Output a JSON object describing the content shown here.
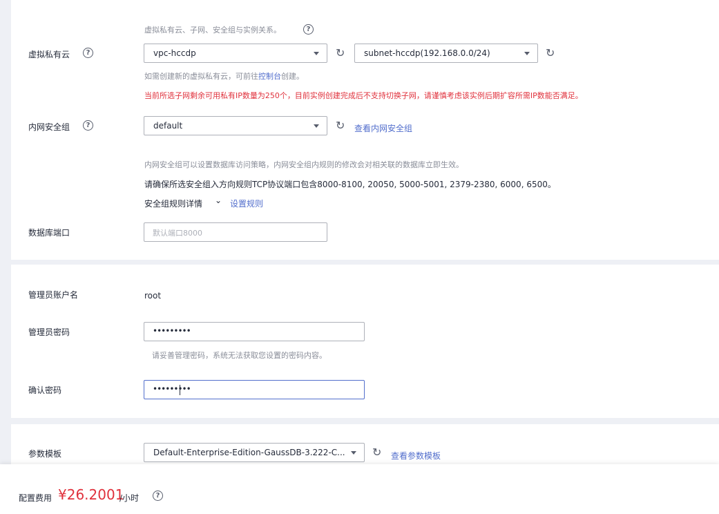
{
  "vpc": {
    "relation_hint": "虚拟私有云、子网、安全组与实例关系。",
    "label": "虚拟私有云",
    "vpc_value": "vpc-hccdp",
    "subnet_value": "subnet-hccdp(192.168.0.0/24)",
    "create_hint_prefix": "如需创建新的虚拟私有云，可前往",
    "create_hint_link": "控制台",
    "create_hint_suffix": "创建。",
    "warning": "当前所选子网剩余可用私有IP数量为250个，目前实例创建完成后不支持切换子网，请谨慎考虑该实例后期扩容所需IP数能否满足。"
  },
  "security_group": {
    "label": "内网安全组",
    "value": "default",
    "view_link": "查看内网安全组",
    "hint": "内网安全组可以设置数据库访问策略，内网安全组内规则的修改会对相关联的数据库立即生效。",
    "ports_note": "请确保所选安全组入方向规则TCP协议端口包含8000-8100, 20050, 5000-5001, 2379-2380, 6000, 6500。",
    "rules_detail": "安全组规则详情",
    "set_rules_link": "设置规则"
  },
  "db_port": {
    "label": "数据库端口",
    "placeholder": "默认端口8000"
  },
  "admin": {
    "account_label": "管理员账户名",
    "account_value": "root",
    "password_label": "管理员密码",
    "password_value": "•••••••••",
    "password_hint": "请妥善管理密码，系统无法获取您设置的密码内容。",
    "confirm_label": "确认密码",
    "confirm_value": "•••••••••"
  },
  "param_template": {
    "label": "参数模板",
    "value": "Default-Enterprise-Edition-GaussDB-3.222-C...",
    "view_link": "查看参数模板"
  },
  "footer": {
    "label": "配置费用",
    "price": "¥26.2001",
    "unit": "/小时"
  },
  "icons": {
    "help": "question-circle-icon",
    "refresh": "refresh-icon",
    "dropdown": "chevron-down-icon"
  },
  "colors": {
    "link": "#526ecc",
    "warning": "#e0313c",
    "price": "#e0313c",
    "hint": "#8a8e99"
  }
}
